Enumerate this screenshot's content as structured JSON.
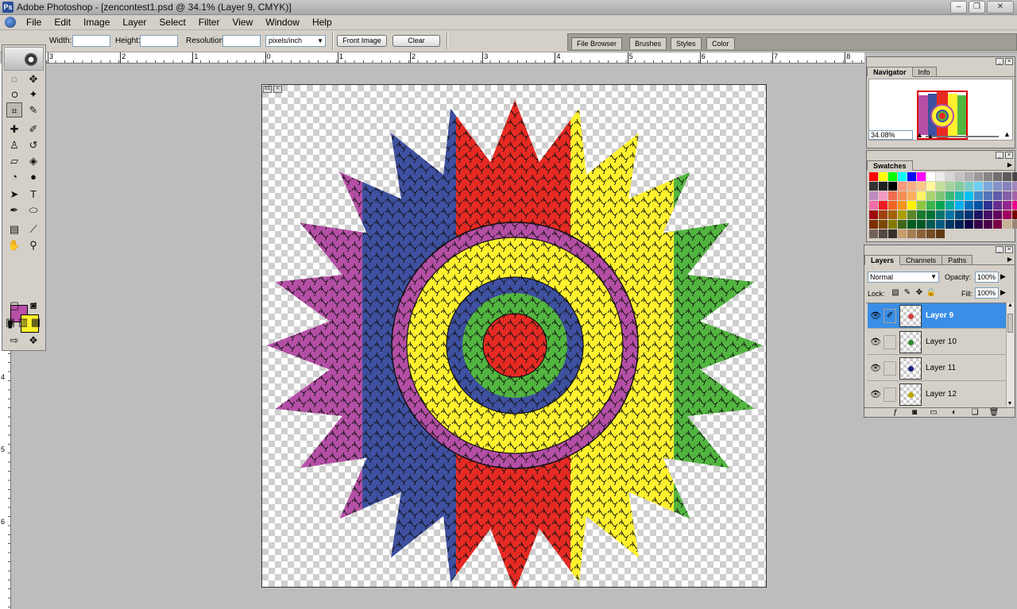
{
  "window": {
    "title": "Adobe Photoshop - [zencontest1.psd @ 34.1% (Layer 9, CMYK)]",
    "app_icon": "Ps",
    "minimize": "–",
    "restore": "❐",
    "close": "✕"
  },
  "menubar": {
    "items": [
      "File",
      "Edit",
      "Image",
      "Layer",
      "Select",
      "Filter",
      "View",
      "Window",
      "Help"
    ]
  },
  "options": {
    "width_label": "Width:",
    "width_value": "",
    "height_label": "Height:",
    "height_value": "",
    "resolution_label": "Resolution:",
    "resolution_value": "",
    "units_value": "pixels/inch",
    "front_image": "Front Image",
    "clear": "Clear"
  },
  "palette_well": {
    "tabs": [
      "File Browser",
      "Brushes",
      "Styles",
      "Color"
    ]
  },
  "rulers": {
    "h_labels": [
      "3",
      "2",
      "1",
      "0",
      "1",
      "2",
      "3",
      "4",
      "5",
      "6",
      "7",
      "8"
    ],
    "v_labels": [
      "4",
      "5",
      "6"
    ]
  },
  "doc": {
    "tag": "01"
  },
  "toolbox": {
    "fg_color": "#b84fa8",
    "bg_color": "#fff22a"
  },
  "navigator": {
    "tabs": [
      "Navigator",
      "Info"
    ],
    "zoom": "34.08%"
  },
  "swatches": {
    "tab": "Swatches",
    "colors": [
      "#ff0000",
      "#ffff00",
      "#00ff00",
      "#00ffff",
      "#0000ff",
      "#ff00ff",
      "#ffffff",
      "#ebebeb",
      "#d6d6d6",
      "#c2c2c2",
      "#adadad",
      "#999999",
      "#858585",
      "#707070",
      "#5c5c5c",
      "#474747",
      "#333333",
      "#1f1f1f",
      "#000000",
      "#f5987c",
      "#f9ad81",
      "#fdc689",
      "#fff79a",
      "#c4df9b",
      "#a3d39c",
      "#82ca9c",
      "#7accc8",
      "#6dcff6",
      "#7da7d9",
      "#8393ca",
      "#8781bd",
      "#a187be",
      "#bd8cbf",
      "#f49ac1",
      "#f26c4f",
      "#f68e55",
      "#fbaf5c",
      "#fff467",
      "#acd372",
      "#7cc576",
      "#3bb878",
      "#1abbb4",
      "#00bff3",
      "#438ccb",
      "#5574b9",
      "#605ca8",
      "#855fa8",
      "#a763a8",
      "#f06ea9",
      "#ed1c24",
      "#f26522",
      "#f7941d",
      "#fff200",
      "#8dc63f",
      "#39b54a",
      "#00a651",
      "#00a99d",
      "#00aeef",
      "#0072bc",
      "#0054a6",
      "#2e3192",
      "#662d91",
      "#92278f",
      "#ec008c",
      "#9e0b0f",
      "#a0410d",
      "#a36209",
      "#aba000",
      "#598527",
      "#1a7b30",
      "#007236",
      "#00746b",
      "#0076a3",
      "#004b80",
      "#003471",
      "#1b1464",
      "#440e62",
      "#630460",
      "#9e005d",
      "#790000",
      "#7b2e00",
      "#7d4900",
      "#827b00",
      "#406618",
      "#005e20",
      "#005826",
      "#005952",
      "#005b7f",
      "#003663",
      "#002157",
      "#0d004c",
      "#32004b",
      "#4b0049",
      "#7b0046",
      "#c7b299",
      "#998675",
      "#736357",
      "#534741",
      "#37302a",
      "#c69c6d",
      "#a67c52",
      "#8c6239",
      "#754c24",
      "#603913"
    ]
  },
  "layers": {
    "tabs": [
      "Layers",
      "Channels",
      "Paths"
    ],
    "blend_mode": "Normal",
    "opacity_label": "Opacity:",
    "opacity": "100%",
    "lock_label": "Lock:",
    "fill_label": "Fill:",
    "fill": "100%",
    "items": [
      {
        "name": "Layer 9",
        "dot": "#d04040"
      },
      {
        "name": "Layer 10",
        "dot": "#2d8a2d"
      },
      {
        "name": "Layer 11",
        "dot": "#1a237e"
      },
      {
        "name": "Layer 12",
        "dot": "#b8a600"
      }
    ]
  },
  "mandala": {
    "colors": {
      "magenta": "#b44fa5",
      "blue": "#3e50a0",
      "red": "#e62a23",
      "yellow": "#fff12e",
      "green": "#52b540"
    }
  }
}
